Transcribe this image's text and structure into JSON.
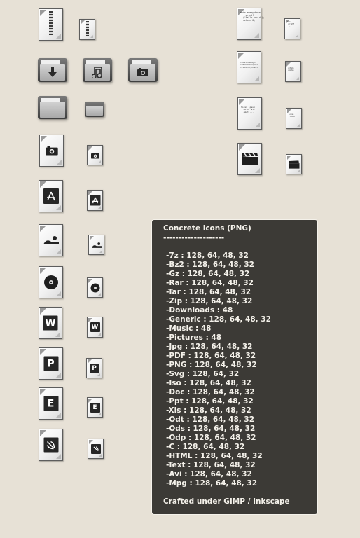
{
  "info_panel": {
    "title": "Concrete icons (PNG)",
    "separator": "--------------------",
    "formats": [
      "-7z : 128, 64, 48, 32",
      "-Bz2 : 128, 64, 48, 32",
      "-Gz : 128, 64, 48, 32",
      "-Rar : 128, 64, 48, 32",
      "-Tar : 128, 64, 48, 32",
      "-Zip : 128, 64, 48, 32",
      "-Downloads : 48",
      "-Generic : 128, 64, 48, 32",
      "-Music : 48",
      "-Pictures : 48",
      "-Jpg : 128, 64, 48, 32",
      "-PDF : 128, 64, 48, 32",
      "-PNG : 128, 64, 48, 32",
      "-Svg : 128, 64, 32",
      "-Iso : 128, 64, 48, 32",
      "-Doc : 128, 64, 48, 32",
      "-Ppt : 128, 64, 48, 32",
      "-Xls : 128, 64, 48, 32",
      "-Odt : 128, 64, 48, 32",
      "-Ods : 128, 64, 48, 32",
      "-Odp : 128, 64, 48, 32",
      "-C : 128, 64, 48, 32",
      "-HTML : 128, 64, 48, 32",
      "-Text : 128, 64, 48, 32",
      "-Avi : 128, 64, 48, 32",
      "-Mpg : 128, 64, 48, 32"
    ],
    "footer": "Crafted under GIMP / Inkscape"
  },
  "icon_letters": {
    "doc": "W",
    "ppt": "P",
    "xls": "E"
  },
  "source_snippets": {
    "c_large": "main everywhere\n    printf\n  ('hello world');\n  return 0;",
    "c_small": "main\n printf\n ...",
    "html_large": "<html><body>\n<h1>hello</h1>\n</body></html>",
    "html_small": "<html>\n<body>",
    "text_large": "lorem ipsum\n  dolor sit\n  amet ...",
    "text_small": "lorem\n ipsum"
  },
  "colors": {
    "background": "#e7e1d6",
    "panel": "#3c3a36",
    "panel_text": "#f4f1ea"
  },
  "icons": [
    "archive-icon",
    "downloads-folder-icon",
    "music-folder-icon",
    "pictures-folder-icon",
    "generic-folder-icon",
    "jpg-icon",
    "pdf-icon",
    "png-icon",
    "iso-icon",
    "doc-icon",
    "ppt-icon",
    "xls-icon",
    "svg-icon",
    "c-source-icon",
    "html-icon",
    "text-icon",
    "video-icon"
  ]
}
